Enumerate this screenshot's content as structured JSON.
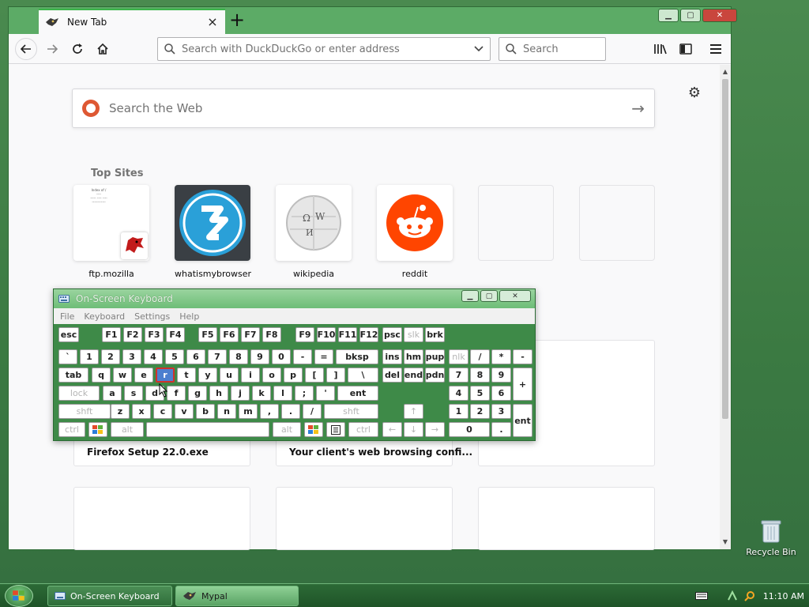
{
  "browser": {
    "tab_title": "New Tab",
    "url_placeholder": "Search with DuckDuckGo or enter address",
    "search_placeholder": "Search",
    "web_search_placeholder": "Search the Web",
    "top_sites_title": "Top Sites",
    "top_sites": [
      {
        "label": "ftp.mozilla"
      },
      {
        "label": "whatismybrowser"
      },
      {
        "label": "wikipedia"
      },
      {
        "label": "reddit"
      },
      {
        "label": ""
      },
      {
        "label": ""
      }
    ],
    "highlights": [
      {
        "title": "Firefox Setup 22.0.exe"
      },
      {
        "title": "Your client's web browsing confi..."
      }
    ]
  },
  "osk": {
    "title": "On-Screen Keyboard",
    "menu": [
      "File",
      "Keyboard",
      "Settings",
      "Help"
    ],
    "selected_key": "r",
    "keys": {
      "esc": "esc",
      "f1": "F1",
      "f2": "F2",
      "f3": "F3",
      "f4": "F4",
      "f5": "F5",
      "f6": "F6",
      "f7": "F7",
      "f8": "F8",
      "f9": "F9",
      "f10": "F10",
      "f11": "F11",
      "f12": "F12",
      "psc": "psc",
      "slk": "slk",
      "brk": "brk",
      "grave": "`",
      "n1": "1",
      "n2": "2",
      "n3": "3",
      "n4": "4",
      "n5": "5",
      "n6": "6",
      "n7": "7",
      "n8": "8",
      "n9": "9",
      "n0": "0",
      "minus": "-",
      "equals": "=",
      "bksp": "bksp",
      "ins": "ins",
      "hm": "hm",
      "pup": "pup",
      "nlk": "nlk",
      "kslash": "/",
      "kstar": "*",
      "kminus": "-",
      "tab": "tab",
      "q": "q",
      "w": "w",
      "e": "e",
      "r": "r",
      "t": "t",
      "y": "y",
      "u": "u",
      "i": "i",
      "o": "o",
      "p": "p",
      "lbr": "[",
      "rbr": "]",
      "bslash": "\\",
      "del": "del",
      "end": "end",
      "pdn": "pdn",
      "k7": "7",
      "k8": "8",
      "k9": "9",
      "kplus": "+",
      "lock": "lock",
      "a": "a",
      "s": "s",
      "d": "d",
      "f": "f",
      "g": "g",
      "h": "h",
      "j": "j",
      "k": "k",
      "l": "l",
      "semi": ";",
      "quote": "'",
      "ent": "ent",
      "k4": "4",
      "k5": "5",
      "k6": "6",
      "lshft": "shft",
      "z": "z",
      "x": "x",
      "c": "c",
      "v": "v",
      "b": "b",
      "n": "n",
      "m": "m",
      "comma": ",",
      "period": ".",
      "slash": "/",
      "rshft": "shft",
      "up": "↑",
      "k1": "1",
      "k2": "2",
      "k3": "3",
      "kent": "ent",
      "lctrl": "ctrl",
      "lalt": "alt",
      "ralt": "alt",
      "rctrl": "ctrl",
      "left": "←",
      "down": "↓",
      "right": "→",
      "k0": "0",
      "kdot": "."
    }
  },
  "desktop": {
    "recycle_bin": "Recycle Bin"
  },
  "taskbar": {
    "items": [
      {
        "label": "On-Screen Keyboard"
      },
      {
        "label": "Mypal"
      }
    ],
    "clock": "11:10 AM"
  },
  "colors": {
    "accent": "#3bb34a",
    "desktop": "#3f7f45",
    "osk_body": "#3e8a48",
    "selected_key": "#4c7fcf"
  }
}
